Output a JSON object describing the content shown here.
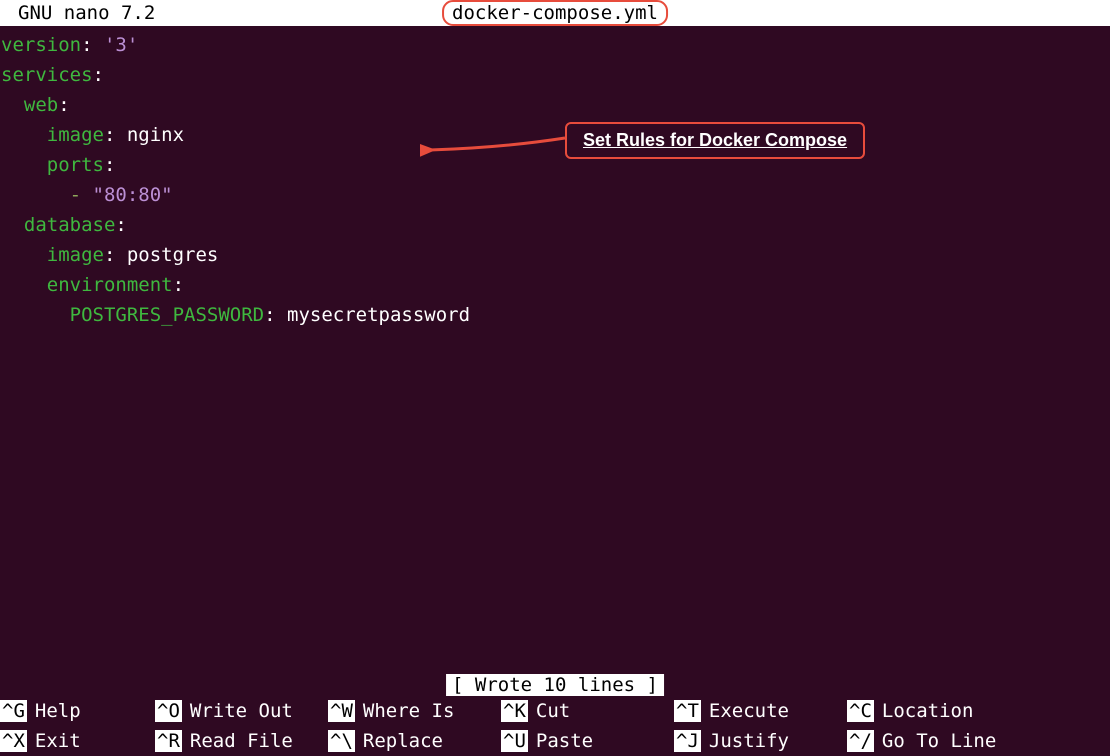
{
  "header": {
    "title": "GNU nano 7.2",
    "filename": "docker-compose.yml"
  },
  "code": {
    "line1_key": "version",
    "line1_colon": ":",
    "line1_value": "'3'",
    "line2_key": "services",
    "line2_colon": ":",
    "line3_key": "  web",
    "line3_colon": ":",
    "line4_key": "    image",
    "line4_colon": ":",
    "line4_value": " nginx",
    "line5_key": "    ports",
    "line5_colon": ":",
    "line6_dash": "      -",
    "line6_value": " \"80:80\"",
    "line7_key": "  database",
    "line7_colon": ":",
    "line8_key": "    image",
    "line8_colon": ":",
    "line8_value": " postgres",
    "line9_key": "    environment",
    "line9_colon": ":",
    "line10_key": "      POSTGRES_PASSWORD",
    "line10_colon": ":",
    "line10_value": " mysecretpassword"
  },
  "annotation": {
    "text": "Set Rules for Docker Compose"
  },
  "status": {
    "message": "[ Wrote 10 lines ]"
  },
  "shortcuts": {
    "row1": {
      "k1": "^G",
      "l1": "Help",
      "k2": "^O",
      "l2": "Write Out",
      "k3": "^W",
      "l3": "Where Is",
      "k4": "^K",
      "l4": "Cut",
      "k5": "^T",
      "l5": "Execute",
      "k6": "^C",
      "l6": "Location"
    },
    "row2": {
      "k1": "^X",
      "l1": "Exit",
      "k2": "^R",
      "l2": "Read File",
      "k3": "^\\",
      "l3": "Replace",
      "k4": "^U",
      "l4": "Paste",
      "k5": "^J",
      "l5": "Justify",
      "k6": "^/",
      "l6": "Go To Line"
    }
  }
}
